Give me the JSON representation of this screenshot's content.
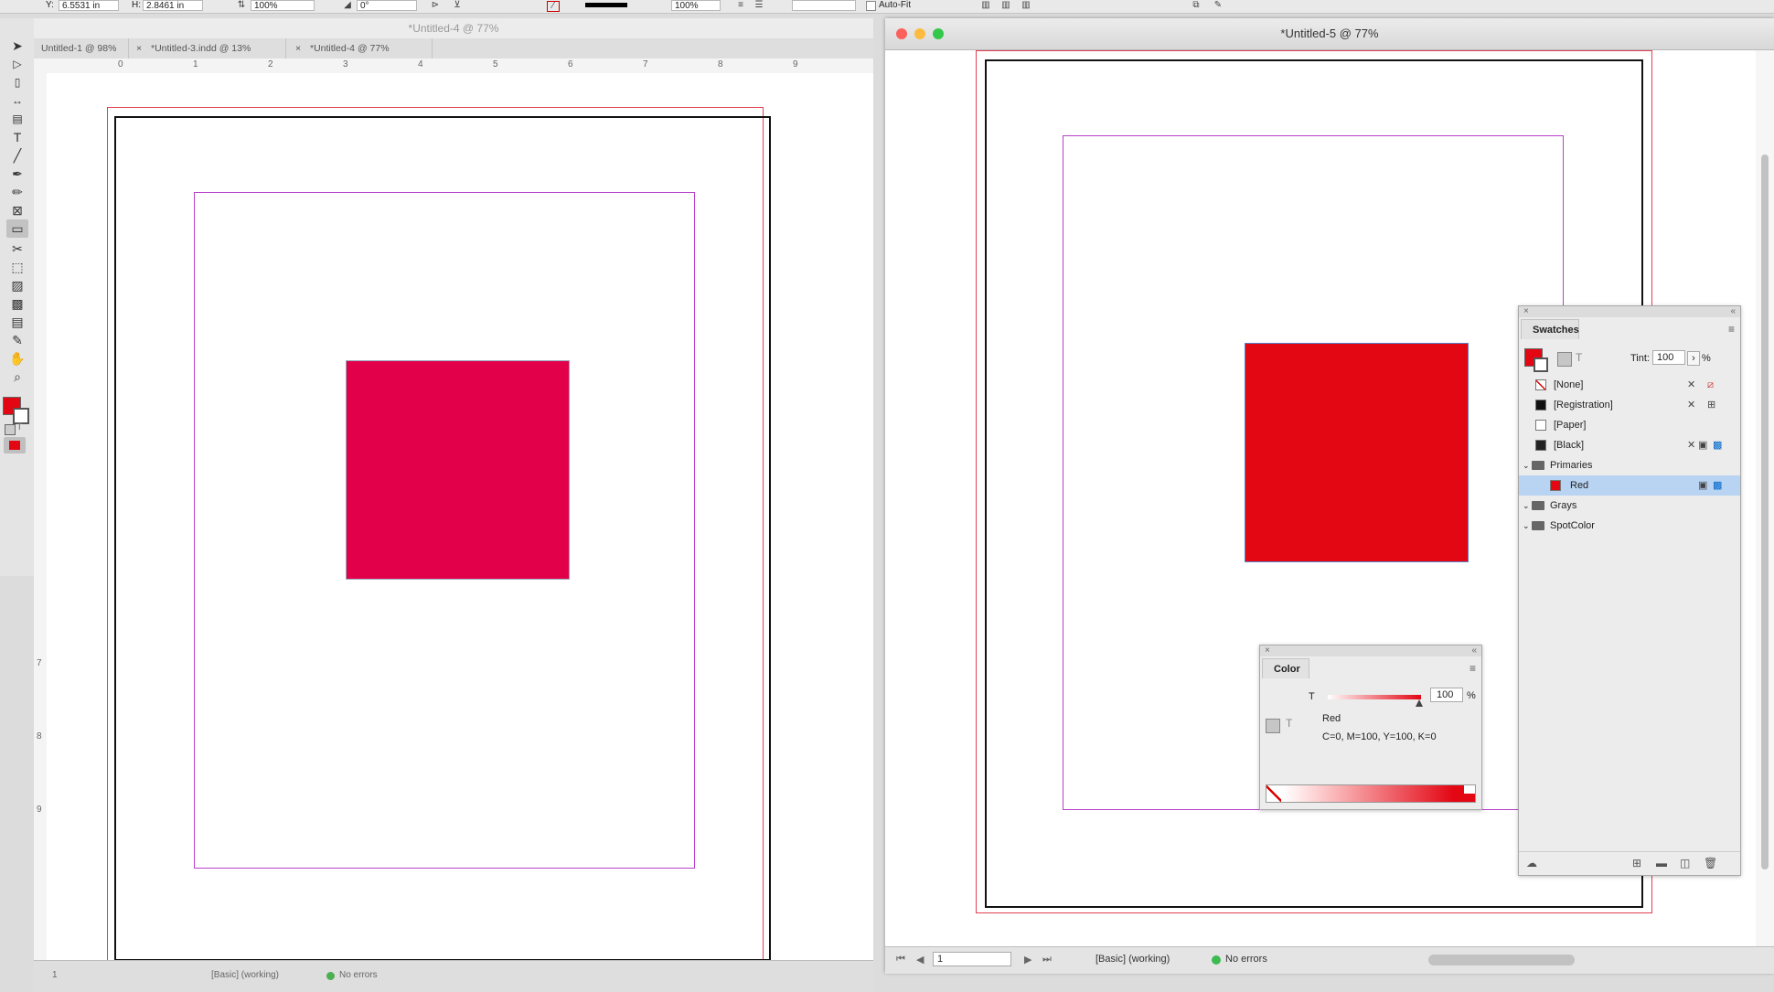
{
  "control_bar": {
    "y_label": "Y:",
    "y_value": "6.5531 in",
    "h_label": "H:",
    "h_value": "2.8461 in",
    "scale_x": "100%",
    "rotate": "0°",
    "scale_pct": "100%",
    "autofit_label": "Auto-Fit"
  },
  "left_window": {
    "title": "*Untitled-4 @ 77%",
    "tabs": [
      {
        "label": "Untitled-1 @ 98%"
      },
      {
        "label": "*Untitled-3.indd @ 13%"
      },
      {
        "label": "*Untitled-4 @ 77%"
      }
    ],
    "ruler_h": [
      "0",
      "1",
      "2",
      "3",
      "4",
      "5",
      "6",
      "7",
      "8",
      "9"
    ],
    "ruler_v": [
      "7",
      "8",
      "9"
    ],
    "status": {
      "page": "1",
      "profile": "[Basic] (working)",
      "errors": "No errors"
    },
    "rect_color": "#e3004a"
  },
  "right_window": {
    "title": "*Untitled-5 @ 77%",
    "status": {
      "page": "1",
      "profile": "[Basic] (working)",
      "errors": "No errors"
    },
    "rect_color": "#e30613"
  },
  "swatches_panel": {
    "title": "Swatches",
    "tint_label": "Tint:",
    "tint_value": "100",
    "tint_unit": "%",
    "items": [
      {
        "label": "[None]"
      },
      {
        "label": "[Registration]"
      },
      {
        "label": "[Paper]"
      },
      {
        "label": "[Black]"
      },
      {
        "label": "Primaries"
      },
      {
        "label": "Red"
      },
      {
        "label": "Grays"
      },
      {
        "label": "SpotColor"
      }
    ]
  },
  "color_panel": {
    "title": "Color",
    "tint_letter": "T",
    "tint_value": "100",
    "tint_unit": "%",
    "swatch_name": "Red",
    "swatch_values": "C=0, M=100, Y=100, K=0"
  },
  "colors": {
    "fill": "#e30613",
    "selection": "#b8d4f2",
    "margin": "#b640c8",
    "bleed": "#e04050"
  }
}
